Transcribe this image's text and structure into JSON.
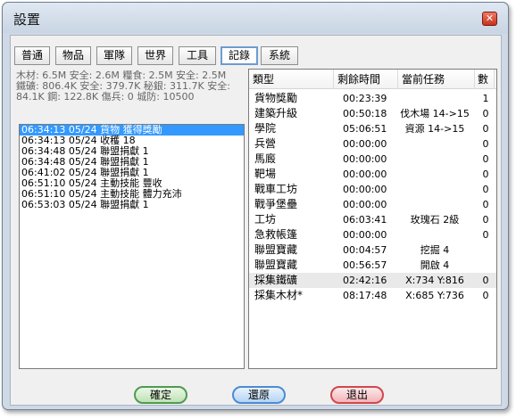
{
  "window": {
    "title": "設置",
    "close_glyph": "✕"
  },
  "tabs": [
    "普通",
    "物品",
    "軍隊",
    "世界",
    "工具",
    "記錄",
    "系統"
  ],
  "active_tab": "記錄",
  "stats": [
    "木材: 6.5M 安全: 2.6M  糧食: 2.5M 安全: 2.5M",
    "鐵礦: 806.4K 安全: 379.7K  秘銀: 311.7K 安全:",
    "84.1K  鋼: 122.8K  傷兵: 0  城防: 10500"
  ],
  "log": [
    {
      "text": "06:34:13 05/24  貨物  獲得獎勵",
      "selected": true
    },
    {
      "text": "06:34:13 05/24  收穫  18",
      "selected": false
    },
    {
      "text": "06:34:48 05/24  聯盟捐獻  1",
      "selected": false
    },
    {
      "text": "06:34:48 05/24  聯盟捐獻  1",
      "selected": false
    },
    {
      "text": "06:41:02 05/24  聯盟捐獻  1",
      "selected": false
    },
    {
      "text": "06:51:10 05/24  主動技能  豐收",
      "selected": false
    },
    {
      "text": "06:51:10 05/24  主動技能  體力充沛",
      "selected": false
    },
    {
      "text": "06:53:03 05/24  聯盟捐獻  1",
      "selected": false
    }
  ],
  "table": {
    "headers": [
      "類型",
      "剩餘時間",
      "當前任務",
      "數"
    ],
    "rows": [
      [
        "貨物獎勵",
        "00:23:39",
        "",
        "1"
      ],
      [
        "建築升級",
        "00:50:18",
        "伐木場 14->15",
        "0"
      ],
      [
        "學院",
        "05:06:51",
        "資源 14->15",
        "0"
      ],
      [
        "兵營",
        "00:00:00",
        "",
        "0"
      ],
      [
        "馬廄",
        "00:00:00",
        "",
        "0"
      ],
      [
        "靶場",
        "00:00:00",
        "",
        "0"
      ],
      [
        "戰車工坊",
        "00:00:00",
        "",
        "0"
      ],
      [
        "戰爭堡壘",
        "00:00:00",
        "",
        "0"
      ],
      [
        "工坊",
        "06:03:41",
        "玫瑰石 2級",
        "0"
      ],
      [
        "急救帳篷",
        "00:00:00",
        "",
        "0"
      ],
      [
        "聯盟寶藏",
        "00:04:57",
        "挖掘 4",
        ""
      ],
      [
        "聯盟寶藏",
        "00:56:57",
        "開啟 4",
        ""
      ],
      [
        "採集鐵礦",
        "02:42:16",
        "X:734 Y:816",
        "0"
      ],
      [
        "採集木材*",
        "08:17:48",
        "X:685 Y:736",
        "0"
      ]
    ],
    "highlighted_row": 12
  },
  "buttons": {
    "ok": "確定",
    "restore": "還原",
    "exit": "退出"
  }
}
